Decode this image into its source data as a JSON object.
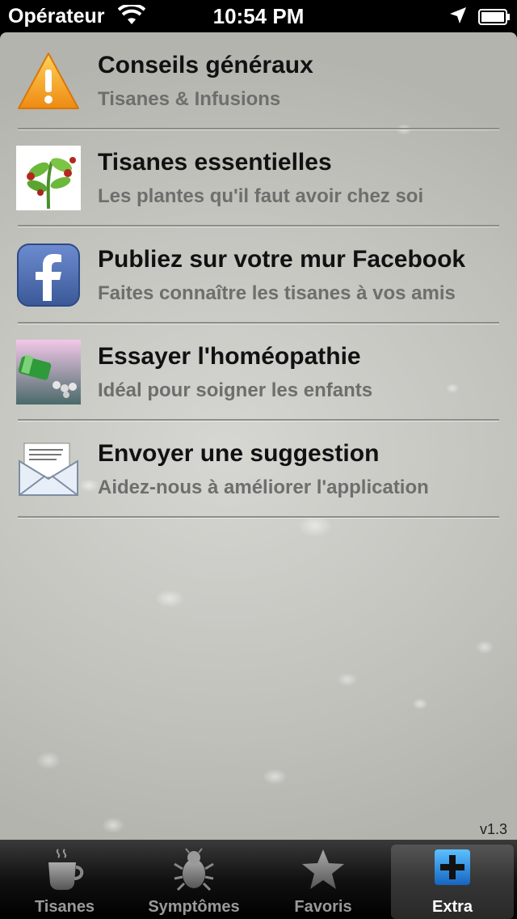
{
  "status_bar": {
    "carrier": "Opérateur",
    "time": "10:54 PM"
  },
  "menu": {
    "items": [
      {
        "title": "Conseils généraux",
        "subtitle": "Tisanes & Infusions",
        "icon": "warning-icon"
      },
      {
        "title": "Tisanes essentielles",
        "subtitle": "Les plantes qu'il faut avoir chez soi",
        "icon": "plant-icon"
      },
      {
        "title": "Publiez sur votre mur Facebook",
        "subtitle": "Faites connaître les tisanes à vos amis",
        "icon": "facebook-icon"
      },
      {
        "title": "Essayer l'homéopathie",
        "subtitle": "Idéal pour soigner les enfants",
        "icon": "homeopathy-icon"
      },
      {
        "title": "Envoyer une suggestion",
        "subtitle": "Aidez-nous à améliorer l'application",
        "icon": "envelope-icon"
      }
    ]
  },
  "version": "v1.3",
  "tab_bar": {
    "tabs": [
      {
        "label": "Tisanes",
        "icon": "teacup-icon",
        "active": false
      },
      {
        "label": "Symptômes",
        "icon": "bug-icon",
        "active": false
      },
      {
        "label": "Favoris",
        "icon": "star-icon",
        "active": false
      },
      {
        "label": "Extra",
        "icon": "plus-icon",
        "active": true
      }
    ]
  },
  "colors": {
    "facebook_blue": "#3b5998",
    "warning_orange": "#f39a1b",
    "active_tab_icon": "#1e88e5"
  }
}
